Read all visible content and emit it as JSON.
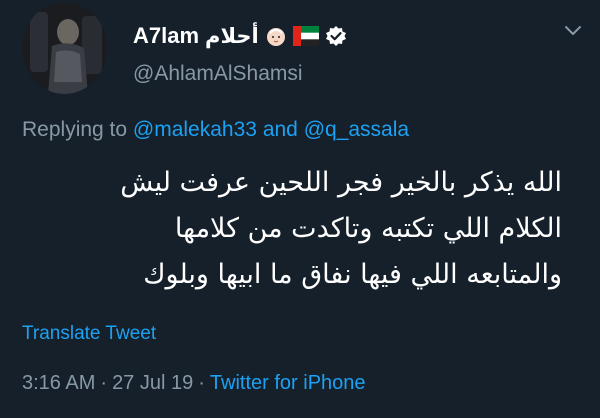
{
  "user": {
    "display_name": "A7lam",
    "display_name_ar": "أحلام",
    "handle": "@AhlamAlShamsi"
  },
  "reply": {
    "prefix": "Replying to",
    "mention_1": "@malekah33",
    "conjunction": "and",
    "mention_2": "@q_assala"
  },
  "tweet": {
    "lines": [
      "الله يذكر بالخير فجر اللحين عرفت ليش",
      "الكلام اللي تكتبه وتاكدت من كلامها",
      "والمتابعه اللي فيها نفاق ما ابيها وبلوك"
    ]
  },
  "translate_label": "Translate Tweet",
  "meta": {
    "time": "3:16 AM",
    "separator": "·",
    "date": "27 Jul 19",
    "source": "Twitter for iPhone"
  },
  "colors": {
    "background": "#15202b",
    "text": "#ffffff",
    "muted": "#8899a6",
    "accent": "#1da1f2"
  },
  "icons": [
    "avatar-photo",
    "baby-face-emoji",
    "uae-flag-emoji",
    "verified-badge-icon",
    "chevron-down-icon"
  ]
}
